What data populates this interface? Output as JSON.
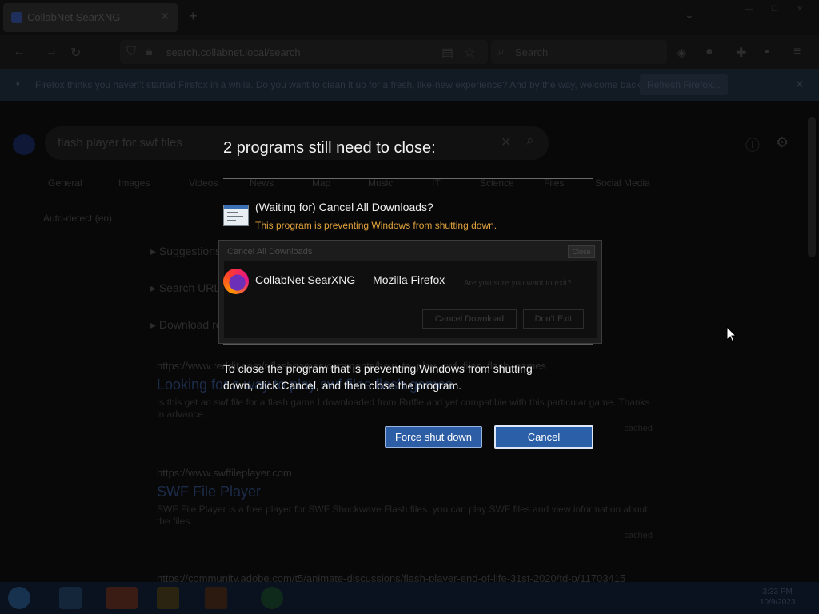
{
  "browser": {
    "tab_title": "CollabNet SearXNG",
    "url": "search.collabnet.local/search",
    "search_placeholder": "Search",
    "notification_text": "Firefox thinks you haven't started Firefox in a while. Do you want to clean it up for a fresh, like-new experience? And by the way, welcome back!",
    "notification_button": "Refresh Firefox..."
  },
  "page": {
    "query": "flash player for swf files",
    "categories": [
      "General",
      "Images",
      "Videos",
      "News",
      "Map",
      "Music",
      "IT",
      "Science",
      "Files",
      "Social Media"
    ],
    "autodetect": "Auto-detect (en)",
    "sections": [
      "Suggestions",
      "Search URL",
      "Download results"
    ],
    "results": [
      {
        "url": "https://www.reddit.com/r/flashgames/comments/how_to_play_swf_files_flash_games",
        "title": "Looking for a way to play swf files flash games",
        "snippet": "Is this get an swf file for a flash game I downloaded from Ruffle and yet compatible with this particular game. Thanks in advance.",
        "links": "cached"
      },
      {
        "url": "https://www.swffileplayer.com",
        "title": "SWF File Player",
        "snippet": "SWF File Player is a free player for SWF Shockwave Flash files. you can play SWF files and view information about the files.",
        "links": "cached"
      },
      {
        "url": "https://community.adobe.com/t5/animate-discussions/flash-player-end-of-life-31st-2020/td-p/11703415",
        "title": "",
        "snippet": "",
        "links": ""
      }
    ]
  },
  "shutdown": {
    "heading": "2 programs still need to close:",
    "program1": {
      "name": "(Waiting for) Cancel All Downloads?",
      "status": "This program is preventing Windows from shutting down.",
      "icon": "app-window-icon"
    },
    "preview": {
      "title": "Cancel All Downloads",
      "close": "Close",
      "question": "Are you sure you want to exit?",
      "button1": "Cancel Download",
      "button2": "Don't Exit"
    },
    "program2": {
      "name": "CollabNet SearXNG — Mozilla Firefox",
      "icon": "firefox-icon"
    },
    "info": "To close the program that is preventing Windows from shutting down, click Cancel, and then close the program.",
    "force_button": "Force shut down",
    "cancel_button": "Cancel"
  },
  "taskbar": {
    "time": "3:33 PM",
    "date": "10/9/2023"
  },
  "colors": {
    "warning": "#e0a23c",
    "button_blue": "#2b5fa8",
    "background": "#0b0b0b"
  }
}
